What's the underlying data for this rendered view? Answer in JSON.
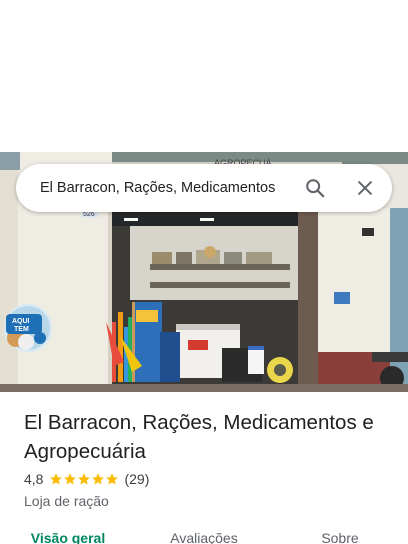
{
  "search": {
    "query": "El Barracon, Rações, Medicamentos"
  },
  "place": {
    "name": "El Barracon, Rações, Medicamentos e Agropecuária",
    "rating": "4,8",
    "rating_value": 4.8,
    "reviews_count": "(29)",
    "category": "Loja de ração"
  },
  "photo": {
    "sign_number": "526",
    "sticker_line1": "AQUI",
    "sticker_line2": "TEM",
    "sign_partial": "AGROPECUÁ"
  },
  "tabs": [
    {
      "label": "Visão geral",
      "active": true
    },
    {
      "label": "Avaliações",
      "active": false
    },
    {
      "label": "Sobre",
      "active": false
    }
  ],
  "colors": {
    "star": "#fbbc04",
    "active_tab": "#01875f",
    "text_primary": "#202124",
    "text_secondary": "#5f6368"
  },
  "icons": {
    "search": "search-icon",
    "close": "close-icon",
    "star": "star-icon"
  }
}
